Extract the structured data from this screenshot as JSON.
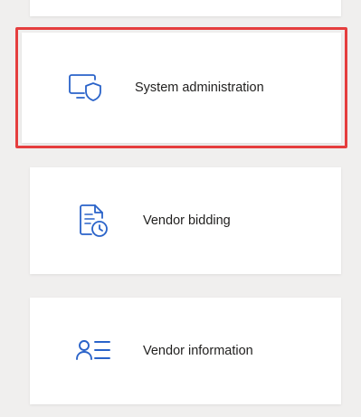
{
  "tiles": [
    {
      "label": "",
      "icon": "none"
    },
    {
      "label": "System administration",
      "icon": "monitor-shield-icon"
    },
    {
      "label": "Vendor bidding",
      "icon": "document-clock-icon"
    },
    {
      "label": "Vendor information",
      "icon": "person-list-icon"
    }
  ],
  "colors": {
    "accent": "#2a63c9",
    "highlight_border": "#e53e3e",
    "background": "#f0efee",
    "tile": "#ffffff"
  }
}
